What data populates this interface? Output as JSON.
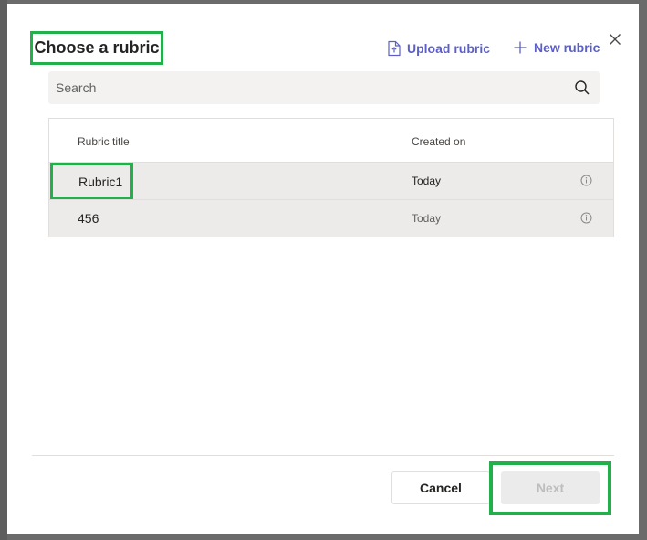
{
  "dialog": {
    "title": "Choose a rubric",
    "close_icon": "close-icon"
  },
  "header_actions": {
    "upload_label": "Upload rubric",
    "upload_icon": "upload-file-icon",
    "new_label": "New rubric",
    "new_icon": "plus-icon"
  },
  "search": {
    "placeholder": "Search",
    "value": "",
    "icon": "search-icon"
  },
  "table": {
    "columns": [
      "Rubric title",
      "Created on"
    ],
    "rows": [
      {
        "title": "Rubric1",
        "created_on": "Today",
        "info_icon": "info-icon"
      },
      {
        "title": "456",
        "created_on": "Today",
        "info_icon": "info-icon"
      }
    ]
  },
  "footer": {
    "cancel_label": "Cancel",
    "next_label": "Next"
  },
  "colors": {
    "accent": "#5b5fc7",
    "highlight": "#22b04b",
    "row_background": "#edebe9",
    "disabled_button": "#ebebeb"
  }
}
